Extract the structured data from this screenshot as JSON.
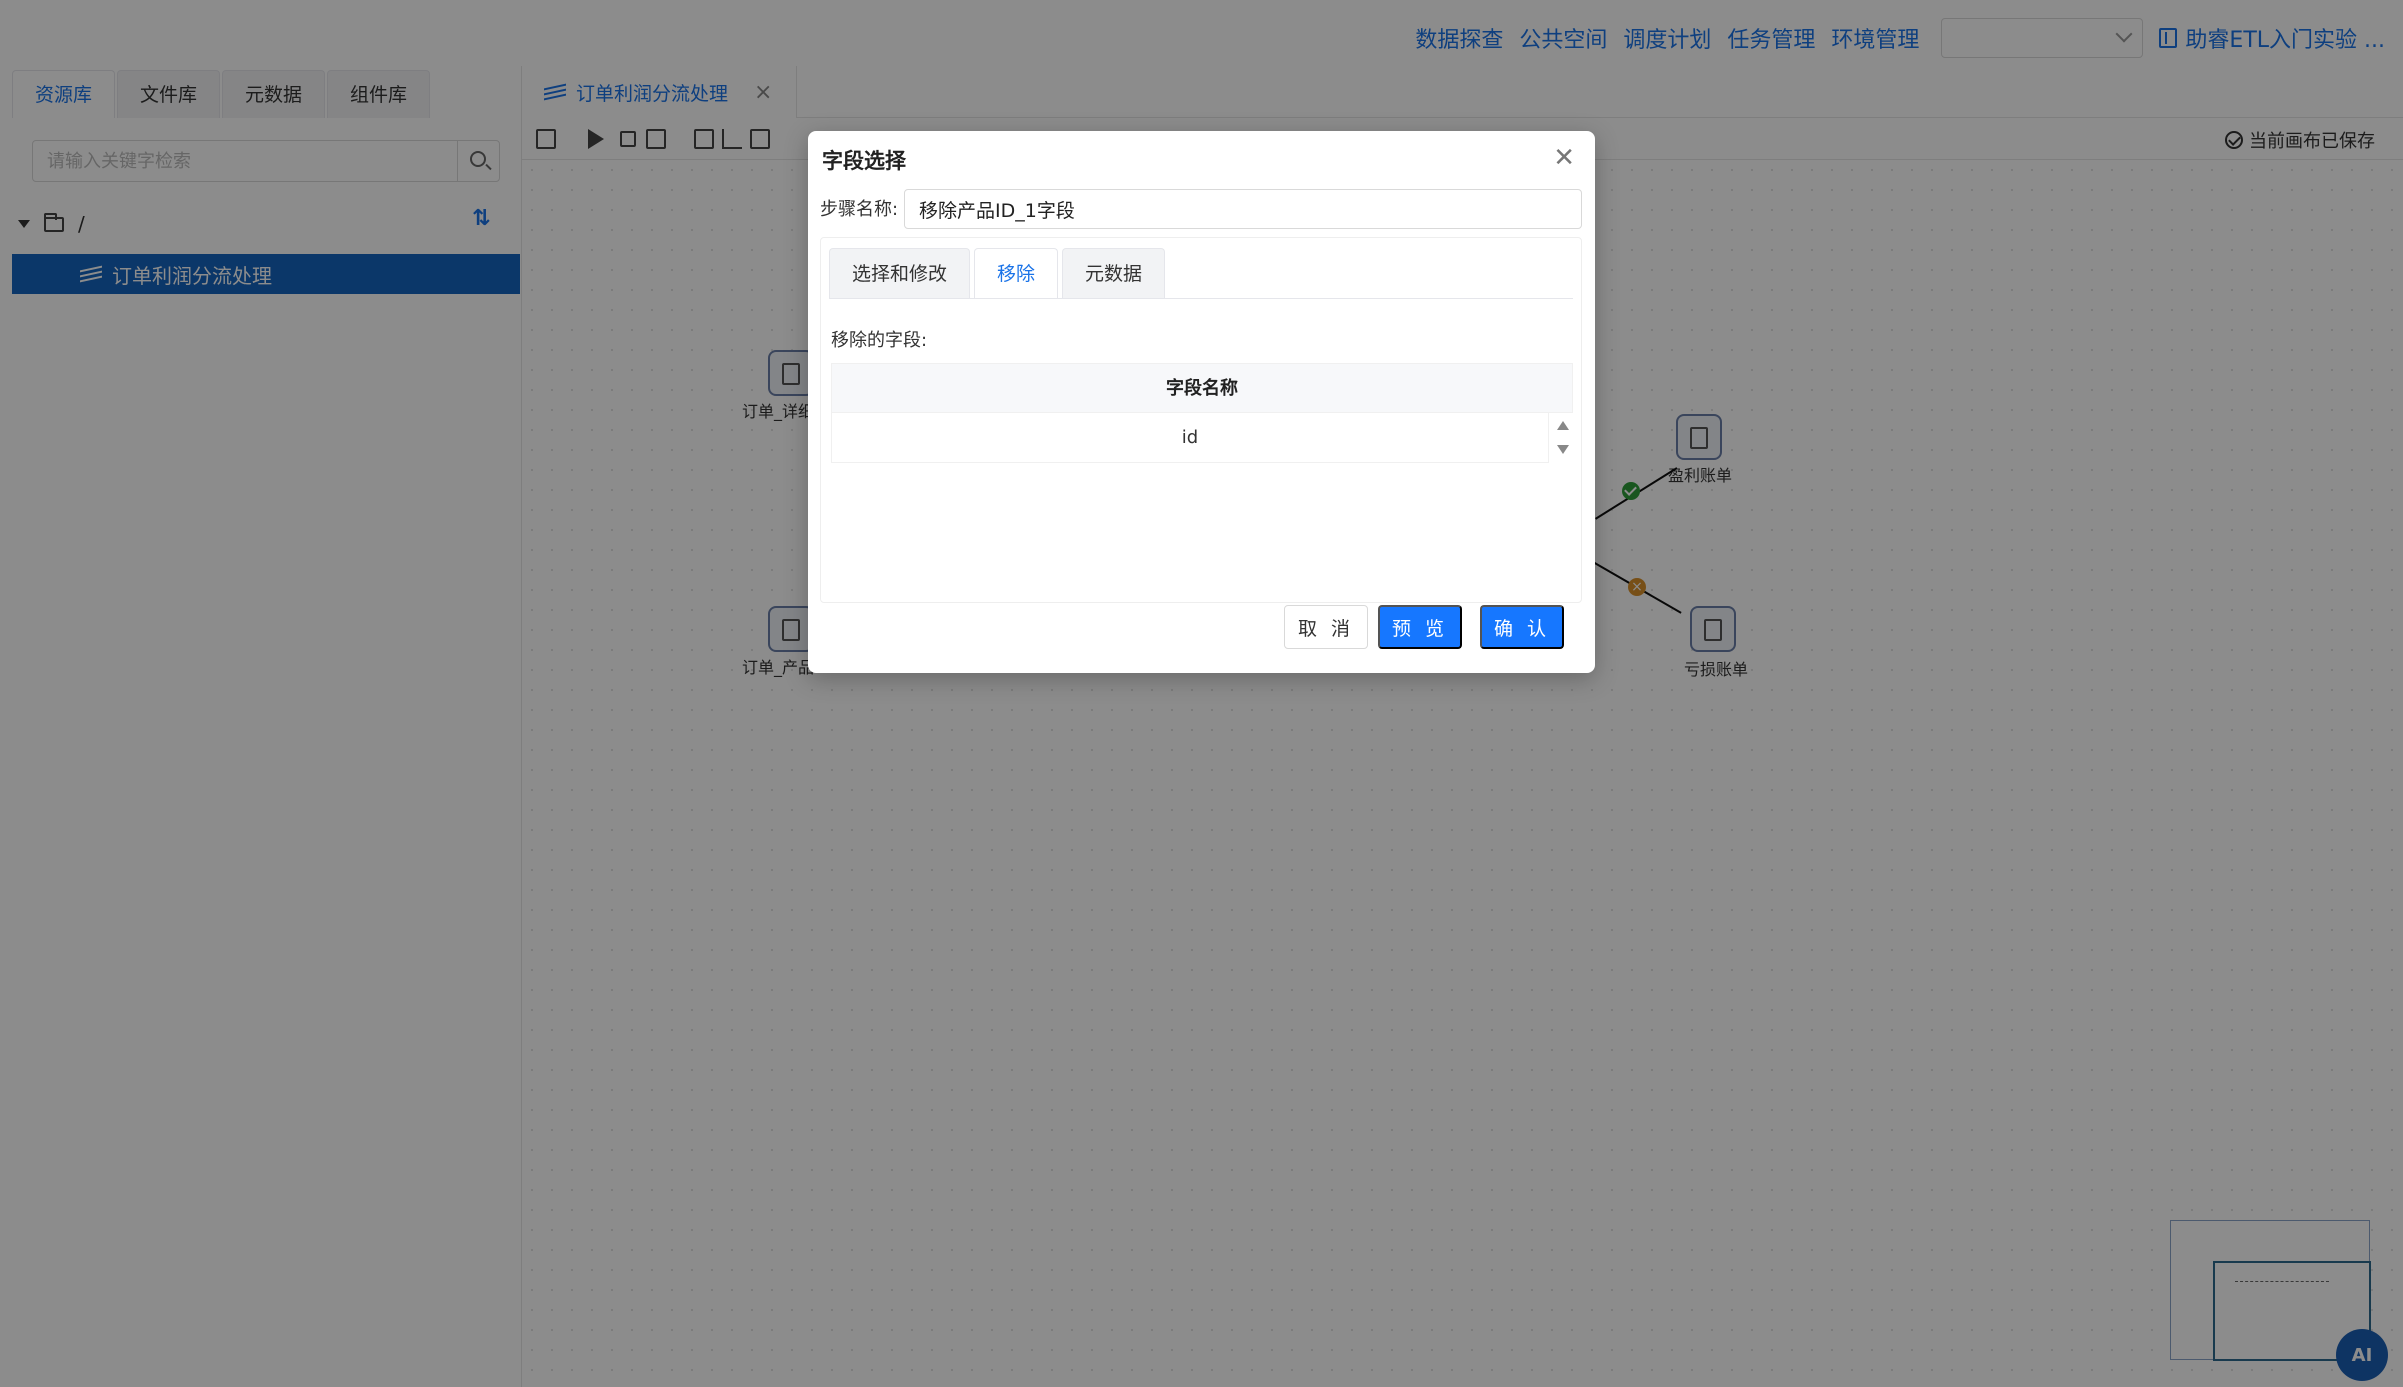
{
  "header": {
    "nav": [
      "数据探查",
      "公共空间",
      "调度计划",
      "任务管理",
      "环境管理"
    ],
    "env_select_value": "",
    "guide_link": "助睿ETL入门实验 ..."
  },
  "left_panel": {
    "tabs": [
      {
        "label": "资源库",
        "active": true
      },
      {
        "label": "文件库",
        "active": false
      },
      {
        "label": "元数据",
        "active": false
      },
      {
        "label": "组件库",
        "active": false
      }
    ],
    "search_placeholder": "请输入关键字检索",
    "tree_root": "/",
    "tree_selected": "订单利润分流处理"
  },
  "editor": {
    "tab_title": "订单利润分流处理",
    "saved_status": "当前画布已保存",
    "nodes": {
      "order_detail": "订单_详细",
      "order_product": "订单_产品",
      "profit_bill": "盈利账单",
      "loss_bill": "亏损账单"
    },
    "ai_label": "AI"
  },
  "dialog": {
    "title": "字段选择",
    "step_label": "步骤名称:",
    "step_value": "移除产品ID_1字段",
    "tabs": [
      {
        "label": "选择和修改",
        "active": false
      },
      {
        "label": "移除",
        "active": true
      },
      {
        "label": "元数据",
        "active": false
      }
    ],
    "removed_label": "移除的字段:",
    "table_header": "字段名称",
    "rows": [
      "id"
    ],
    "buttons": {
      "cancel": "取 消",
      "preview": "预 览",
      "confirm": "确 认"
    }
  }
}
